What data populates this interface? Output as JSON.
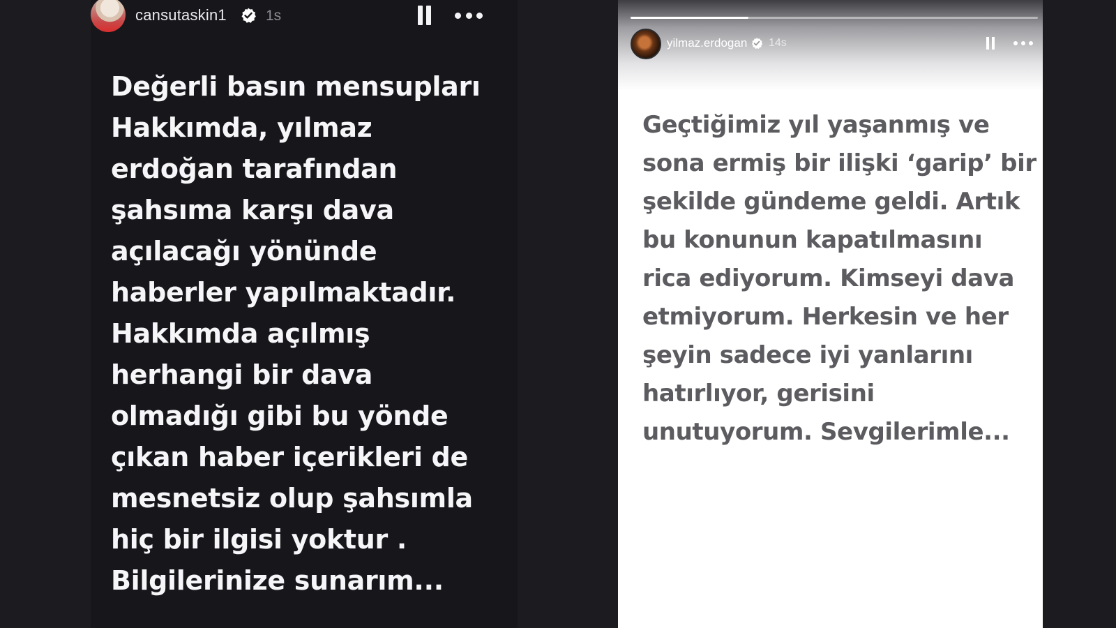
{
  "left_story": {
    "username": "cansutaskin1",
    "time": "1s",
    "verified": true,
    "text_lines": [
      "Değerli basın mensupları",
      "Hakkımda, yılmaz",
      "erdoğan tarafından",
      "şahsıma karşı dava",
      "açılacağı yönünde",
      "haberler yapılmaktadır.",
      "Hakkımda açılmış",
      "herhangi bir dava",
      "olmadığı gibi bu yönde",
      "çıkan haber içerikleri de",
      "mesnetsiz olup şahsımla",
      "hiç bir ilgisi yoktur .",
      "Bilgilerinize sunarım..."
    ]
  },
  "right_story": {
    "username": "yilmaz.erdogan",
    "time": "14s",
    "verified": true,
    "progress": 0.29,
    "text_lines": [
      "Geçtiğimiz yıl yaşanmış ve",
      "sona ermiş bir ilişki ‘garip’ bir",
      "şekilde gündeme geldi.  Artık",
      "bu konunun kapatılmasını",
      "rica ediyorum. Kimseyi dava",
      "etmiyorum. Herkesin ve her",
      "şeyin sadece iyi yanlarını",
      "hatırlıyor, gerisini",
      "unutuyorum. Sevgilerimle..."
    ]
  },
  "icons": {
    "pause": "pause-icon",
    "more": "more-options-icon",
    "verified": "verified-badge-icon"
  },
  "colors": {
    "page_background": "#1c1b20",
    "left_story_background": "#17161b",
    "left_text": "#f6f6f8",
    "right_story_background": "#ffffff",
    "right_text": "#5c5c60",
    "verified_badge": "#ffffff"
  }
}
